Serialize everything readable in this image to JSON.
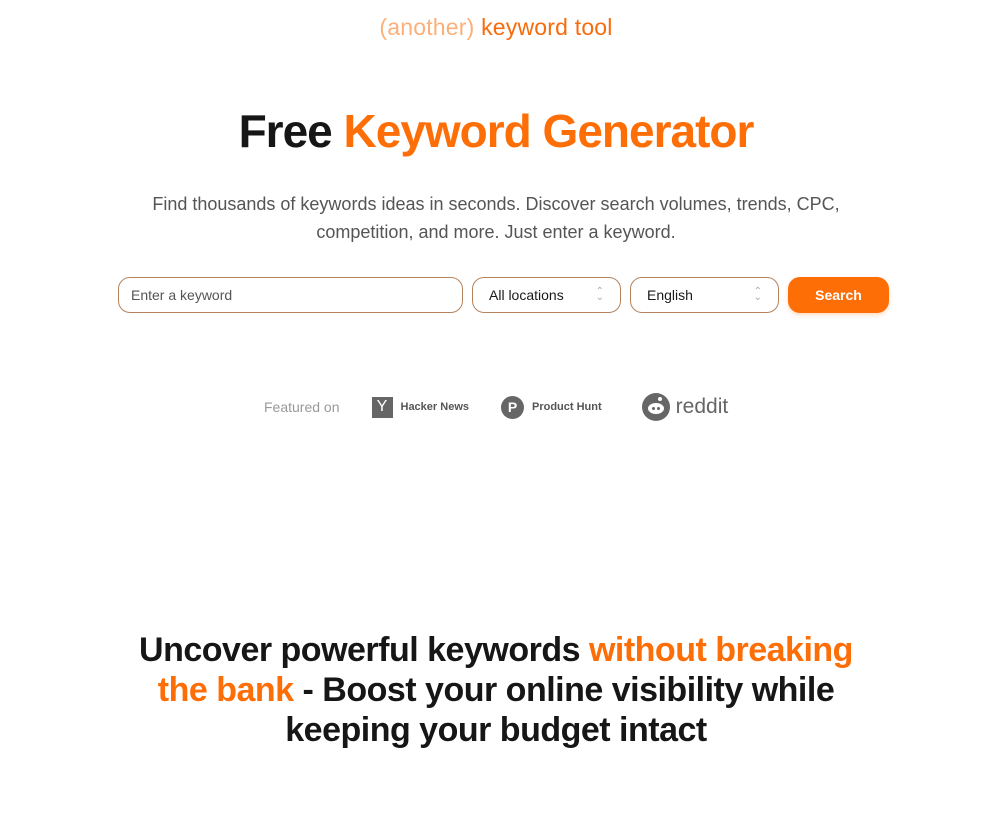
{
  "brand": {
    "prefix": "(another)",
    "name": "keyword tool"
  },
  "hero": {
    "title_plain": "Free",
    "title_accent": "Keyword Generator",
    "subtitle": "Find thousands of keywords ideas in seconds. Discover search volumes, trends, CPC, competition, and more. Just enter a keyword."
  },
  "search": {
    "keyword_placeholder": "Enter a keyword",
    "keyword_value": "",
    "location_selected": "All locations",
    "language_selected": "English",
    "button_label": "Search"
  },
  "featured": {
    "label": "Featured on",
    "items": [
      {
        "name": "Hacker News",
        "icon": "hacker-news-icon",
        "glyph": "Y"
      },
      {
        "name": "Product Hunt",
        "icon": "product-hunt-icon",
        "glyph": "P"
      },
      {
        "name": "reddit",
        "icon": "reddit-icon"
      }
    ]
  },
  "tagline": {
    "part1": "Uncover powerful keywords ",
    "accent": "without breaking the bank",
    "part2": " - Boost your online visibility while keeping your budget intact"
  },
  "colors": {
    "accent": "#fe6e07",
    "brand_muted": "#fbb07a",
    "border": "#b4835e"
  }
}
